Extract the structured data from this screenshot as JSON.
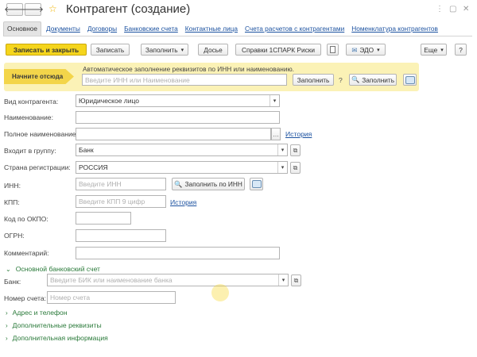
{
  "window": {
    "title": "Контрагент (создание)",
    "back_glyph": "🡐",
    "forward_glyph": "🡒",
    "more_glyph": "⋮",
    "restore_glyph": "▢",
    "close_glyph": "✕"
  },
  "tabs": [
    {
      "label": "Основное",
      "active": true
    },
    {
      "label": "Документы"
    },
    {
      "label": "Договоры"
    },
    {
      "label": "Банковские счета"
    },
    {
      "label": "Контактные лица"
    },
    {
      "label": "Счета расчетов с контрагентами"
    },
    {
      "label": "Номенклатура контрагентов"
    }
  ],
  "toolbar": {
    "save_close": "Записать и закрыть",
    "save": "Записать",
    "fill": "Заполнить",
    "dossier": "Досье",
    "spark": "Справки 1СПАРК Риски",
    "edo": "ЭДО",
    "more": "Еще",
    "help": "?"
  },
  "autofill": {
    "start_label": "Начните отсюда",
    "hint": "Автоматическое заполнение реквизитов по ИНН или наименованию.",
    "placeholder": "Введите ИНН или Наименование",
    "fill_button": "Заполнить",
    "help": "?",
    "fill_button2": "Заполнить"
  },
  "form": {
    "type_label": "Вид контрагента:",
    "type_value": "Юридическое лицо",
    "name_label": "Наименование:",
    "name_value": "",
    "fullname_label": "Полное наименование:",
    "fullname_value": "",
    "history_link": "История",
    "group_label": "Входит в группу:",
    "group_value": "Банк",
    "country_label": "Страна регистрации:",
    "country_value": "РОССИЯ",
    "inn_label": "ИНН:",
    "inn_placeholder": "Введите ИНН",
    "inn_fill_button": "Заполнить по ИНН",
    "kpp_label": "КПП:",
    "kpp_placeholder": "Введите КПП 9 цифр",
    "kpp_history_link": "История",
    "okpo_label": "Код по ОКПО:",
    "okpo_value": "",
    "ogrn_label": "ОГРН:",
    "ogrn_value": "",
    "comment_label": "Комментарий:",
    "comment_value": ""
  },
  "bank": {
    "section_title": "Основной банковский счет",
    "bank_label": "Банк:",
    "bank_placeholder": "Введите БИК или наименование банка",
    "account_label": "Номер счета:",
    "account_placeholder": "Номер счета"
  },
  "sections": {
    "address": "Адрес и телефон",
    "extra": "Дополнительные реквизиты",
    "info": "Дополнительная информация"
  },
  "colors": {
    "primary": "#f5d51c",
    "panel": "#fbf2b6",
    "link": "#1c52a0",
    "section": "#2a7a3a"
  }
}
